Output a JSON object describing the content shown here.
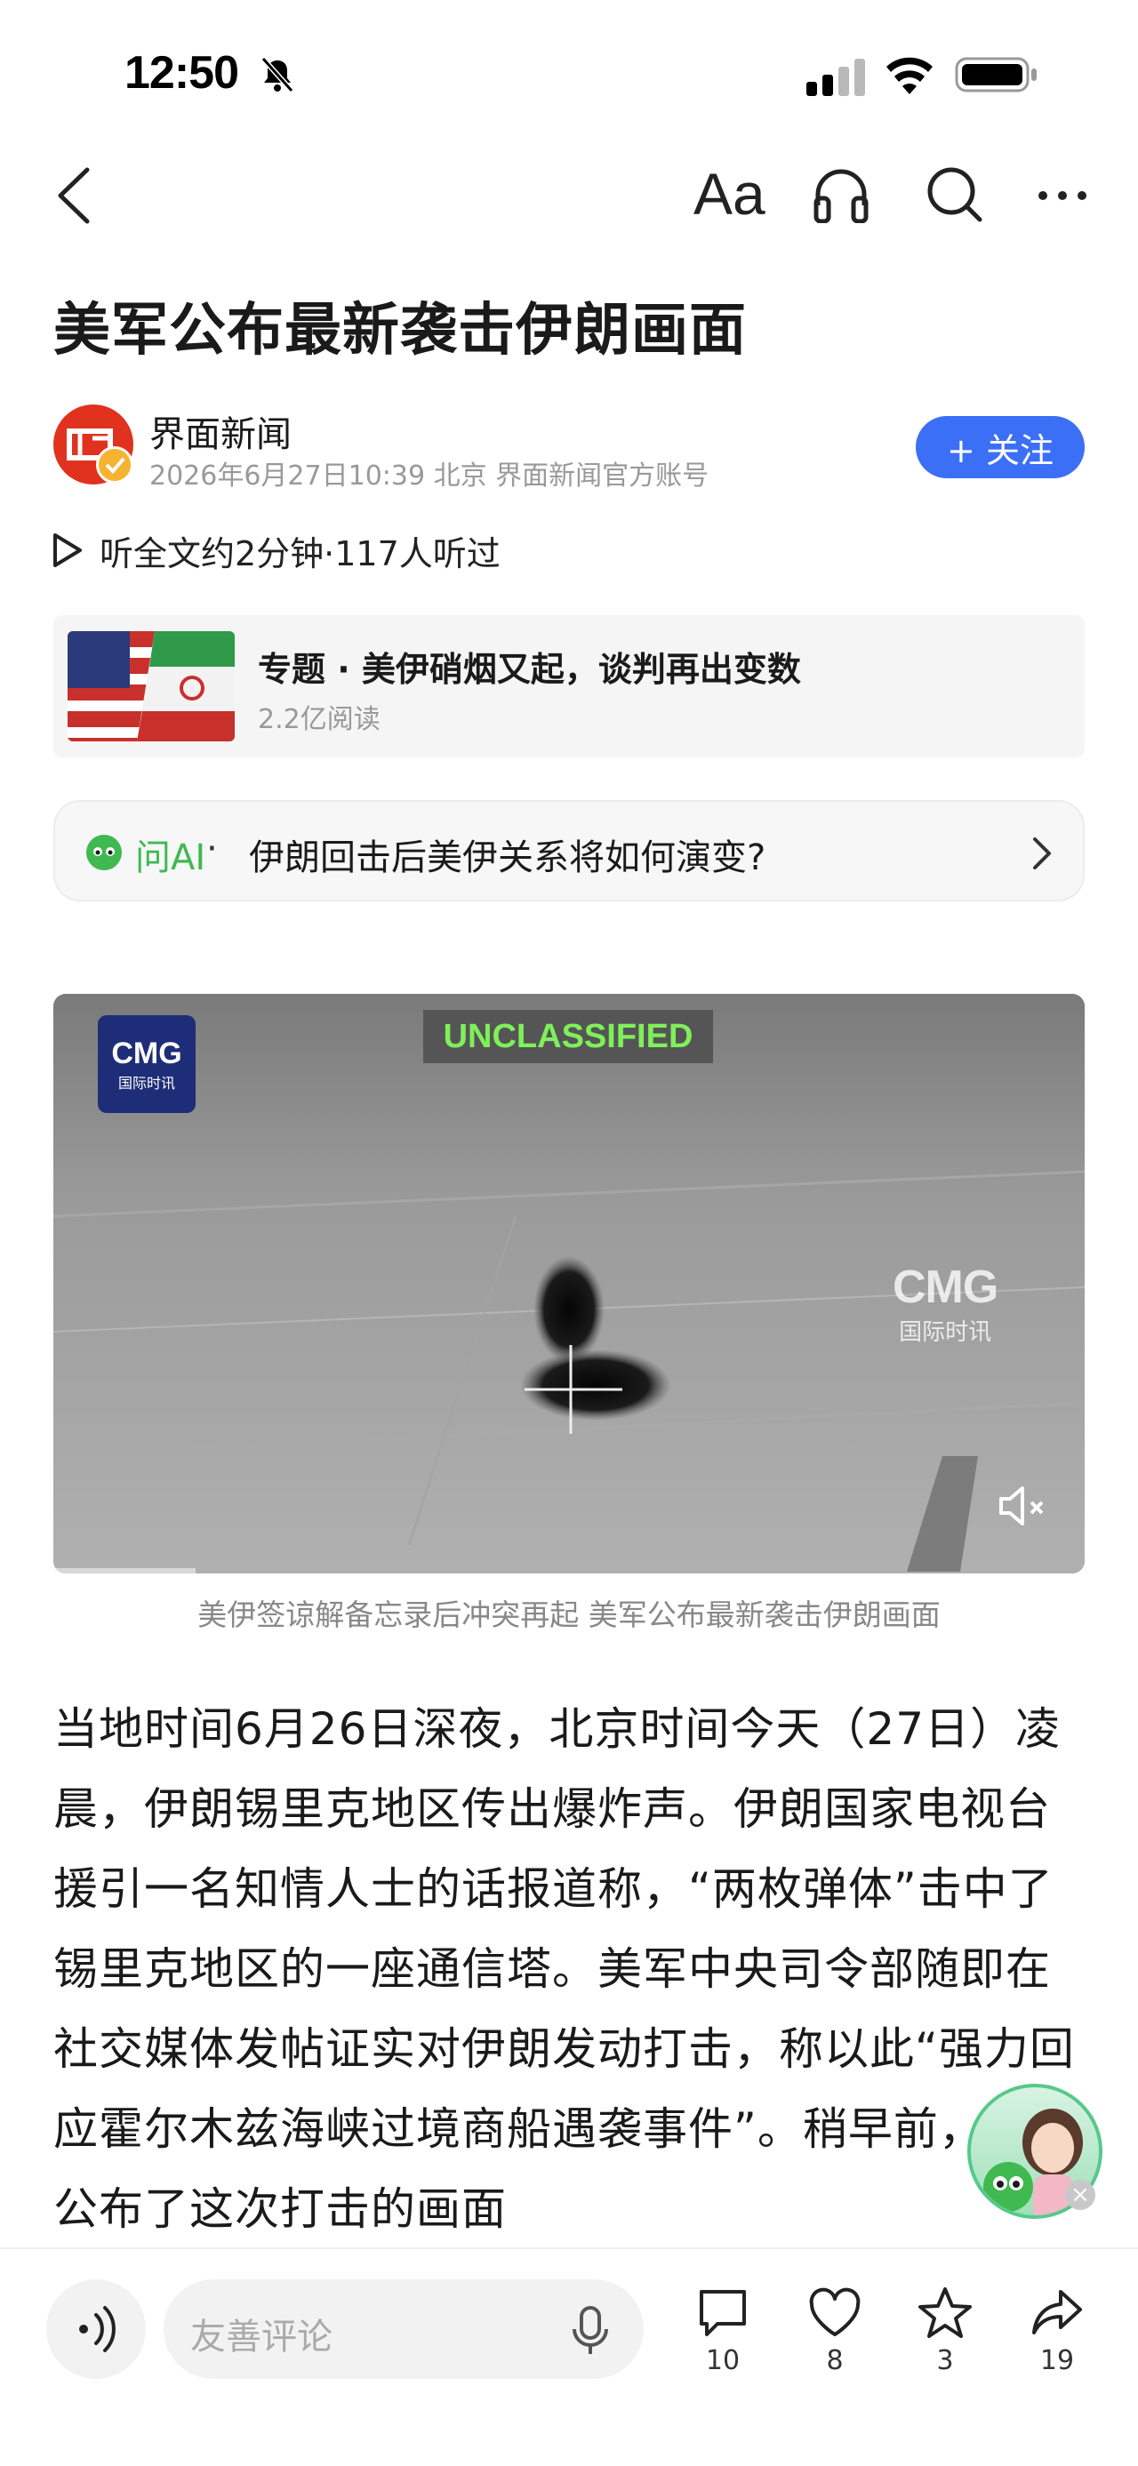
{
  "status_bar": {
    "time": "12:50"
  },
  "nav": {
    "font_label": "Aa"
  },
  "article": {
    "title": "美军公布最新袭击伊朗画面",
    "author": "界面新闻",
    "meta": "2026年6月27日10:39 北京 界面新闻官方账号",
    "follow_label": "+ 关注",
    "listen_text": "听全文约2分钟·117人听过",
    "topic": {
      "title": "专题 · 美伊硝烟又起，谈判再出变数",
      "reads": "2.2亿阅读"
    },
    "ask_ai": {
      "label": "问AI",
      "separator": "·",
      "question": "伊朗回击后美伊关系将如何演变?"
    },
    "video": {
      "banner": "UNCLASSIFIED",
      "logo_top": "CMG",
      "logo_bottom": "国际时讯",
      "watermark_top": "CMG",
      "watermark_bottom": "国际时讯",
      "caption": "美伊签谅解备忘录后冲突再起 美军公布最新袭击伊朗画面"
    },
    "body": "当地时间6月26日深夜，北京时间今天（27日）凌晨，伊朗锡里克地区传出爆炸声。伊朗国家电视台援引一名知情人士的话报道称，“两枚弹体”击中了锡里克地区的一座通信塔。美军中央司令部随即在社交媒体发帖证实对伊朗发动打击，称以此“强力回应霍尔木兹海峡过境商船遇袭事件”。稍早前，美军公布了这次打击的画面"
  },
  "bottom_bar": {
    "comment_placeholder": "友善评论",
    "actions": [
      {
        "icon": "comment-icon",
        "count": "10"
      },
      {
        "icon": "heart-icon",
        "count": "8"
      },
      {
        "icon": "star-icon",
        "count": "3"
      },
      {
        "icon": "share-icon",
        "count": "19"
      }
    ]
  },
  "colors": {
    "accent_blue": "#3b6ff5",
    "ai_green": "#3fb950",
    "brand_red": "#e0321e"
  }
}
